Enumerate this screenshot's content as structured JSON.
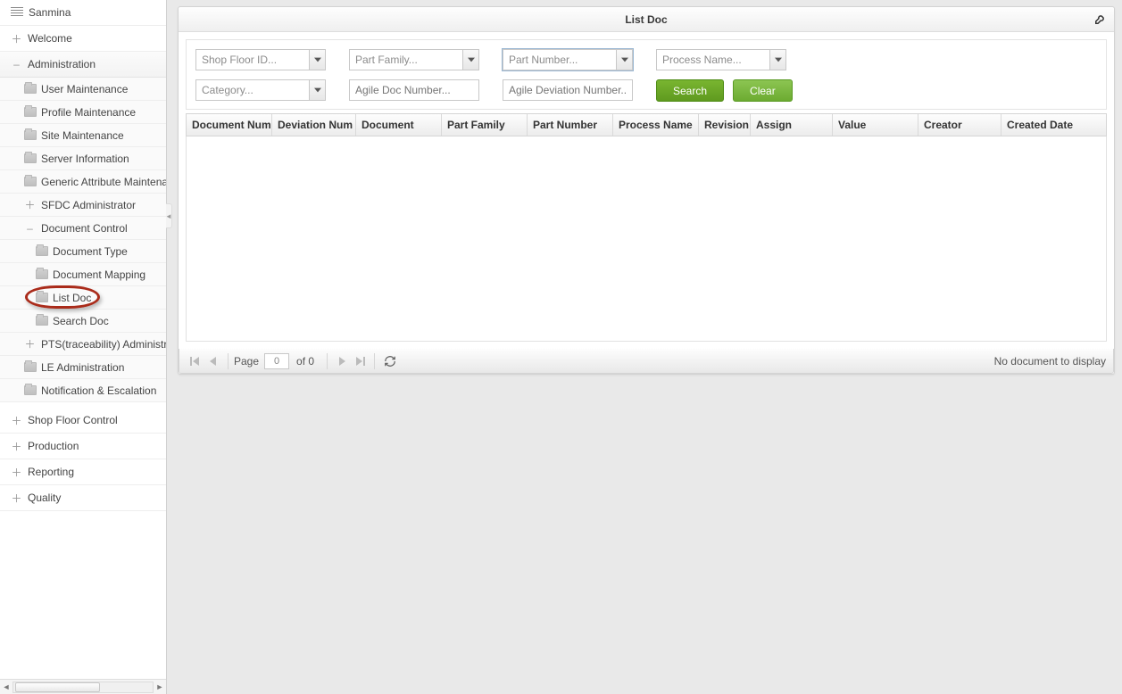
{
  "app_title": "Sanmina",
  "sidebar": {
    "items": [
      {
        "label": "Sanmina",
        "icon": "list"
      },
      {
        "label": "Welcome",
        "icon": "plus"
      },
      {
        "label": "Administration",
        "icon": "minus",
        "children": [
          {
            "label": "User Maintenance",
            "icon": "folder"
          },
          {
            "label": "Profile Maintenance",
            "icon": "folder"
          },
          {
            "label": "Site Maintenance",
            "icon": "folder"
          },
          {
            "label": "Server Information",
            "icon": "folder"
          },
          {
            "label": "Generic Attribute Maintenance",
            "icon": "folder"
          },
          {
            "label": "SFDC Administrator",
            "icon": "plus"
          },
          {
            "label": "Document Control",
            "icon": "minus",
            "children": [
              {
                "label": "Document Type",
                "icon": "folder"
              },
              {
                "label": "Document Mapping",
                "icon": "folder"
              },
              {
                "label": "List Doc",
                "icon": "folder",
                "selected": true
              },
              {
                "label": "Search Doc",
                "icon": "folder"
              }
            ]
          },
          {
            "label": "PTS(traceability) Administration",
            "icon": "plus"
          },
          {
            "label": "LE Administration",
            "icon": "folder"
          },
          {
            "label": "Notification & Escalation",
            "icon": "folder"
          }
        ]
      },
      {
        "label": "Shop Floor Control",
        "icon": "plus"
      },
      {
        "label": "Production",
        "icon": "plus"
      },
      {
        "label": "Reporting",
        "icon": "plus"
      },
      {
        "label": "Quality",
        "icon": "plus"
      }
    ]
  },
  "panel": {
    "title": "List Doc"
  },
  "filters": {
    "shop_floor_id": "Shop Floor ID...",
    "part_family": "Part Family...",
    "part_number": "Part Number...",
    "process_name": "Process Name...",
    "category": "Category...",
    "agile_doc_number": "Agile Doc Number...",
    "agile_deviation_number": "Agile Deviation Number..."
  },
  "buttons": {
    "search": "Search",
    "clear": "Clear"
  },
  "columns": {
    "doc_num": "Document Num",
    "dev_num": "Deviation Num",
    "document": "Document",
    "part_family": "Part Family",
    "part_number": "Part Number",
    "process_name": "Process Name",
    "revision": "Revision",
    "assign": "Assign",
    "value": "Value",
    "creator": "Creator",
    "created_date": "Created Date"
  },
  "paging": {
    "page_label": "Page",
    "page_value": "0",
    "of_label": "of 0",
    "empty_msg": "No document to display"
  }
}
